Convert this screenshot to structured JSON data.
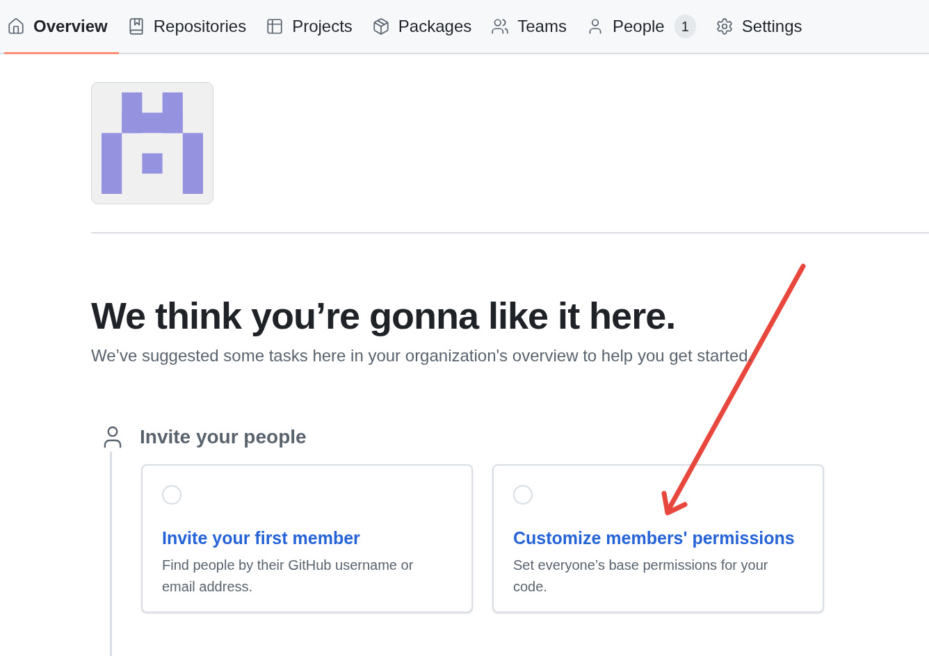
{
  "tabs": [
    {
      "label": "Overview",
      "selected": true
    },
    {
      "label": "Repositories",
      "selected": false
    },
    {
      "label": "Projects",
      "selected": false
    },
    {
      "label": "Packages",
      "selected": false
    },
    {
      "label": "Teams",
      "selected": false
    },
    {
      "label": "People",
      "selected": false,
      "counter": "1"
    },
    {
      "label": "Settings",
      "selected": false
    }
  ],
  "heading": "We think you’re gonna like it here.",
  "subtitle": "We’ve suggested some tasks here in your organization's overview to help you get started.",
  "section": {
    "title": "Invite your people",
    "tasks": [
      {
        "title": "Invite your first member",
        "description": "Find people by their GitHub username or email address.",
        "checked": false
      },
      {
        "title": "Customize members' permissions",
        "description": "Set everyone’s base permissions for your code.",
        "checked": false
      }
    ]
  }
}
